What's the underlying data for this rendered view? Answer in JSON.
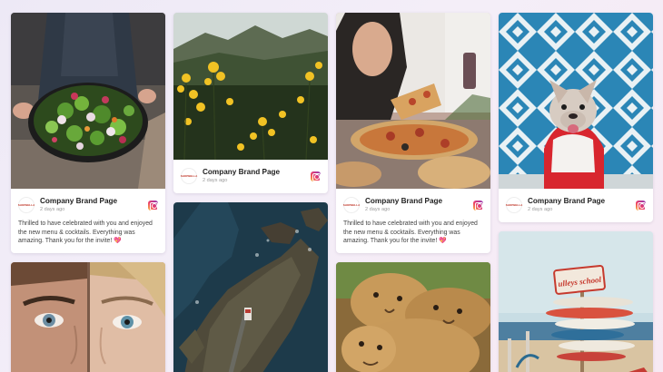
{
  "brand": {
    "name": "Company Brand Page",
    "logo_text": "SHOPBELLA",
    "instagram_icon": "instagram-icon"
  },
  "posts": [
    {
      "id": "salad",
      "date": "2 days ago",
      "caption": "Thrilled to have celebrated with you and enjoyed the new menu & cocktails. Everything was amazing. Thank you for the invite! 💖"
    },
    {
      "id": "flowers",
      "date": "2 days ago",
      "caption": ""
    },
    {
      "id": "pizza",
      "date": "2 days ago",
      "caption": "Thrilled to have celebrated with you and enjoyed the new menu & cocktails. Everything was amazing. Thank you for the invite! 💖"
    },
    {
      "id": "dog",
      "date": "2 days ago",
      "caption": ""
    }
  ],
  "images": {
    "surfboards_sign": "ulleys school"
  },
  "colors": {
    "background": "#f1ecf7",
    "instagram_gradient": [
      "#f9c13b",
      "#ec3b6a",
      "#8a3ab9"
    ]
  }
}
